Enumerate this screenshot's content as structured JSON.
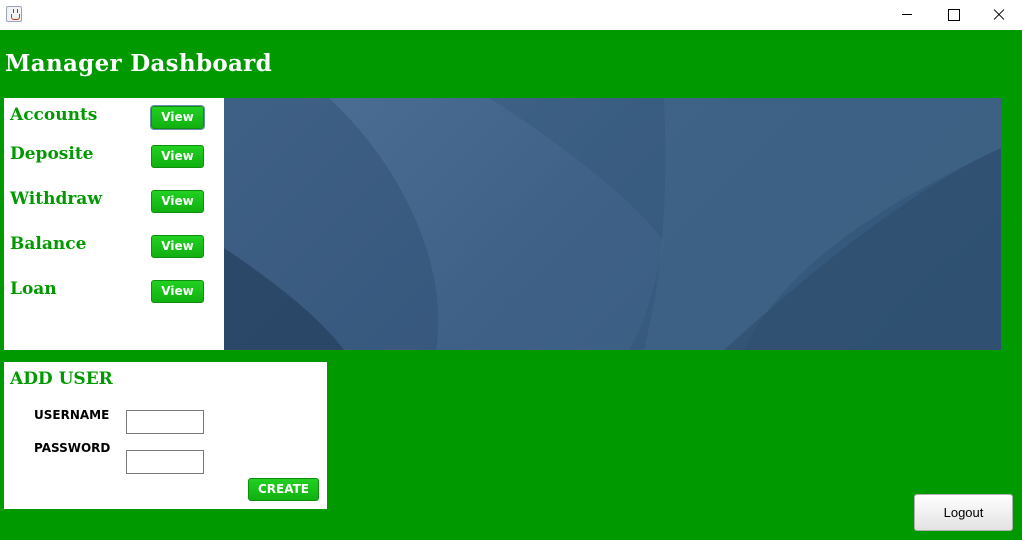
{
  "window": {
    "icon": "java-cup-icon"
  },
  "header": {
    "title": "Manager Dashboard"
  },
  "menu": {
    "items": [
      {
        "label": "Accounts",
        "button": "View"
      },
      {
        "label": "Deposite",
        "button": "View"
      },
      {
        "label": "Withdraw",
        "button": "View"
      },
      {
        "label": "Balance",
        "button": "View"
      },
      {
        "label": "Loan",
        "button": "View"
      }
    ]
  },
  "add_user": {
    "title": "ADD USER",
    "username_label": "USERNAME",
    "password_label": "PASSWORD",
    "username_value": "",
    "password_value": "",
    "create_button": "CREATE"
  },
  "logout_button": "Logout",
  "colors": {
    "background": "#009900",
    "accent_text": "#009900",
    "button_green": "#1cc41c"
  }
}
